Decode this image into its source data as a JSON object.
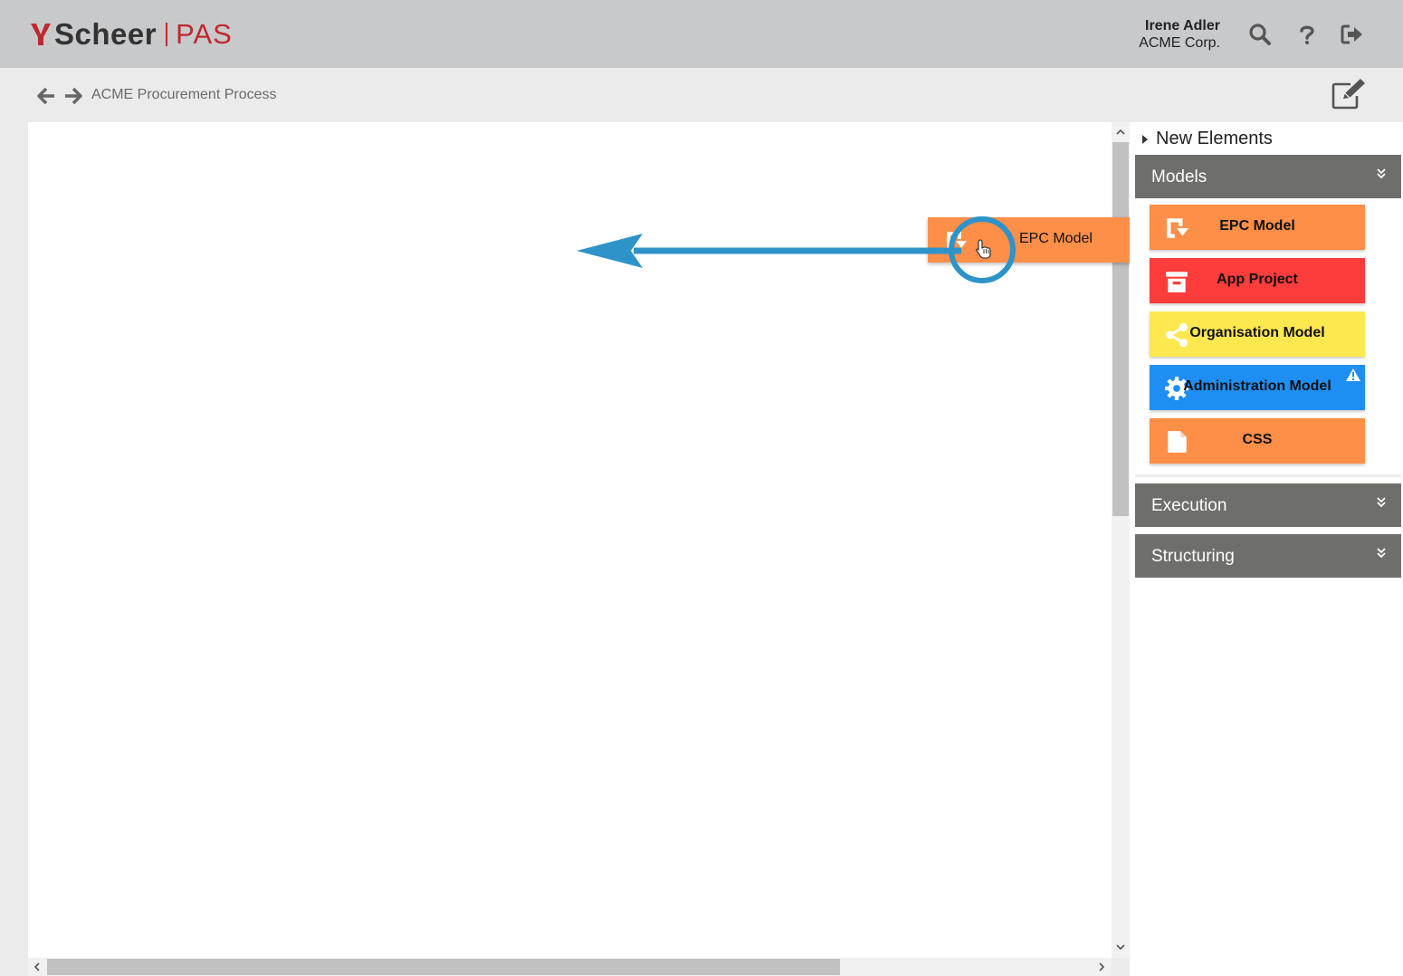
{
  "header": {
    "logo_text": "Scheer",
    "logo_product": "PAS",
    "user_name": "Irene Adler",
    "user_org": "ACME Corp.",
    "icons": [
      "search-icon",
      "help-icon",
      "logout-icon"
    ]
  },
  "breadcrumb": {
    "title": "ACME Procurement Process",
    "icons": [
      "back-arrow-icon",
      "forward-arrow-icon",
      "edit-icon"
    ]
  },
  "canvas": {
    "dragged_element": {
      "label": "EPC Model",
      "icon": "epc-model-icon",
      "color": "#fd8f49"
    },
    "annotation": {
      "type": "drag-arrow",
      "color": "#2e93c9",
      "direction": "left"
    }
  },
  "panel": {
    "new_elements_label": "New Elements",
    "sections": [
      {
        "label": "Models",
        "expanded": true
      },
      {
        "label": "Execution",
        "expanded": false
      },
      {
        "label": "Structuring",
        "expanded": false
      }
    ],
    "models": [
      {
        "label": "EPC Model",
        "color": "#fd8f49",
        "icon": "epc-model-icon"
      },
      {
        "label": "App Project",
        "color": "#fd3c3c",
        "icon": "archive-icon"
      },
      {
        "label": "Organisation Model",
        "color": "#fde84f",
        "icon": "share-icon"
      },
      {
        "label": "Administration Model",
        "color": "#1f8ef3",
        "icon": "gear-icon",
        "warning": true
      },
      {
        "label": "CSS",
        "color": "#fd8f49",
        "icon": "document-icon"
      }
    ]
  }
}
